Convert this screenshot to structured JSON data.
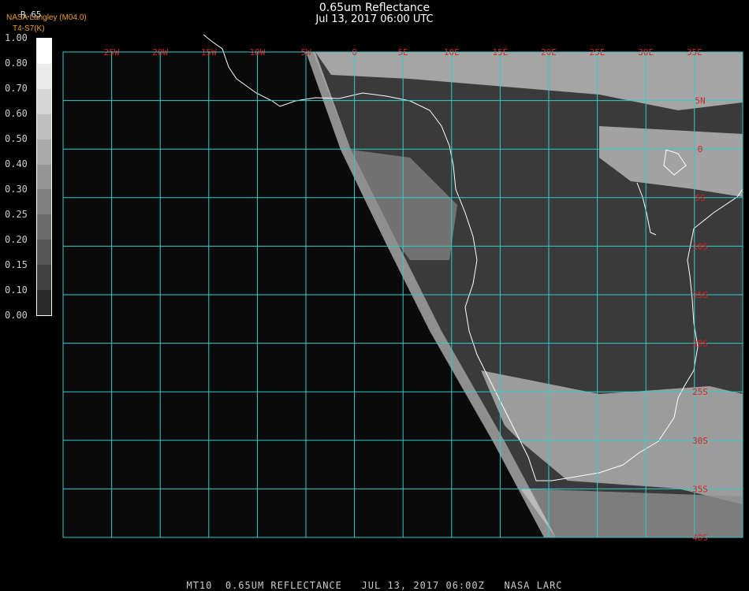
{
  "header": {
    "title": "0.65um Reflectance",
    "datetime": "Jul 13, 2017 06:00 UTC",
    "org": "NASA Langley (M04.0)",
    "product": "T4-S7(K)"
  },
  "colorbar": {
    "title": "R.65",
    "labels": [
      "1.00",
      "0.80",
      "0.70",
      "0.60",
      "0.50",
      "0.40",
      "0.30",
      "0.25",
      "0.20",
      "0.15",
      "0.10",
      "0.00"
    ],
    "colors": [
      "#ffffff",
      "#ececec",
      "#d6d6d6",
      "#c0c0c0",
      "#aaaaaa",
      "#959595",
      "#808080",
      "#6b6b6b",
      "#565656",
      "#404040",
      "#2a2a2a"
    ]
  },
  "map": {
    "lon_labels": [
      "25W",
      "20W",
      "15W",
      "10W",
      "5W",
      "0",
      "5E",
      "10E",
      "15E",
      "20E",
      "25E",
      "30E",
      "35E"
    ],
    "lat_labels": [
      "5N",
      "0",
      "5S",
      "10S",
      "15S",
      "20S",
      "25S",
      "30S",
      "35S",
      "40S"
    ],
    "grid_color": "#33cccc",
    "label_color": "#e02020"
  },
  "footer": {
    "text": "MT10  0.65UM REFLECTANCE   JUL 13, 2017 06:00Z   NASA LARC"
  }
}
